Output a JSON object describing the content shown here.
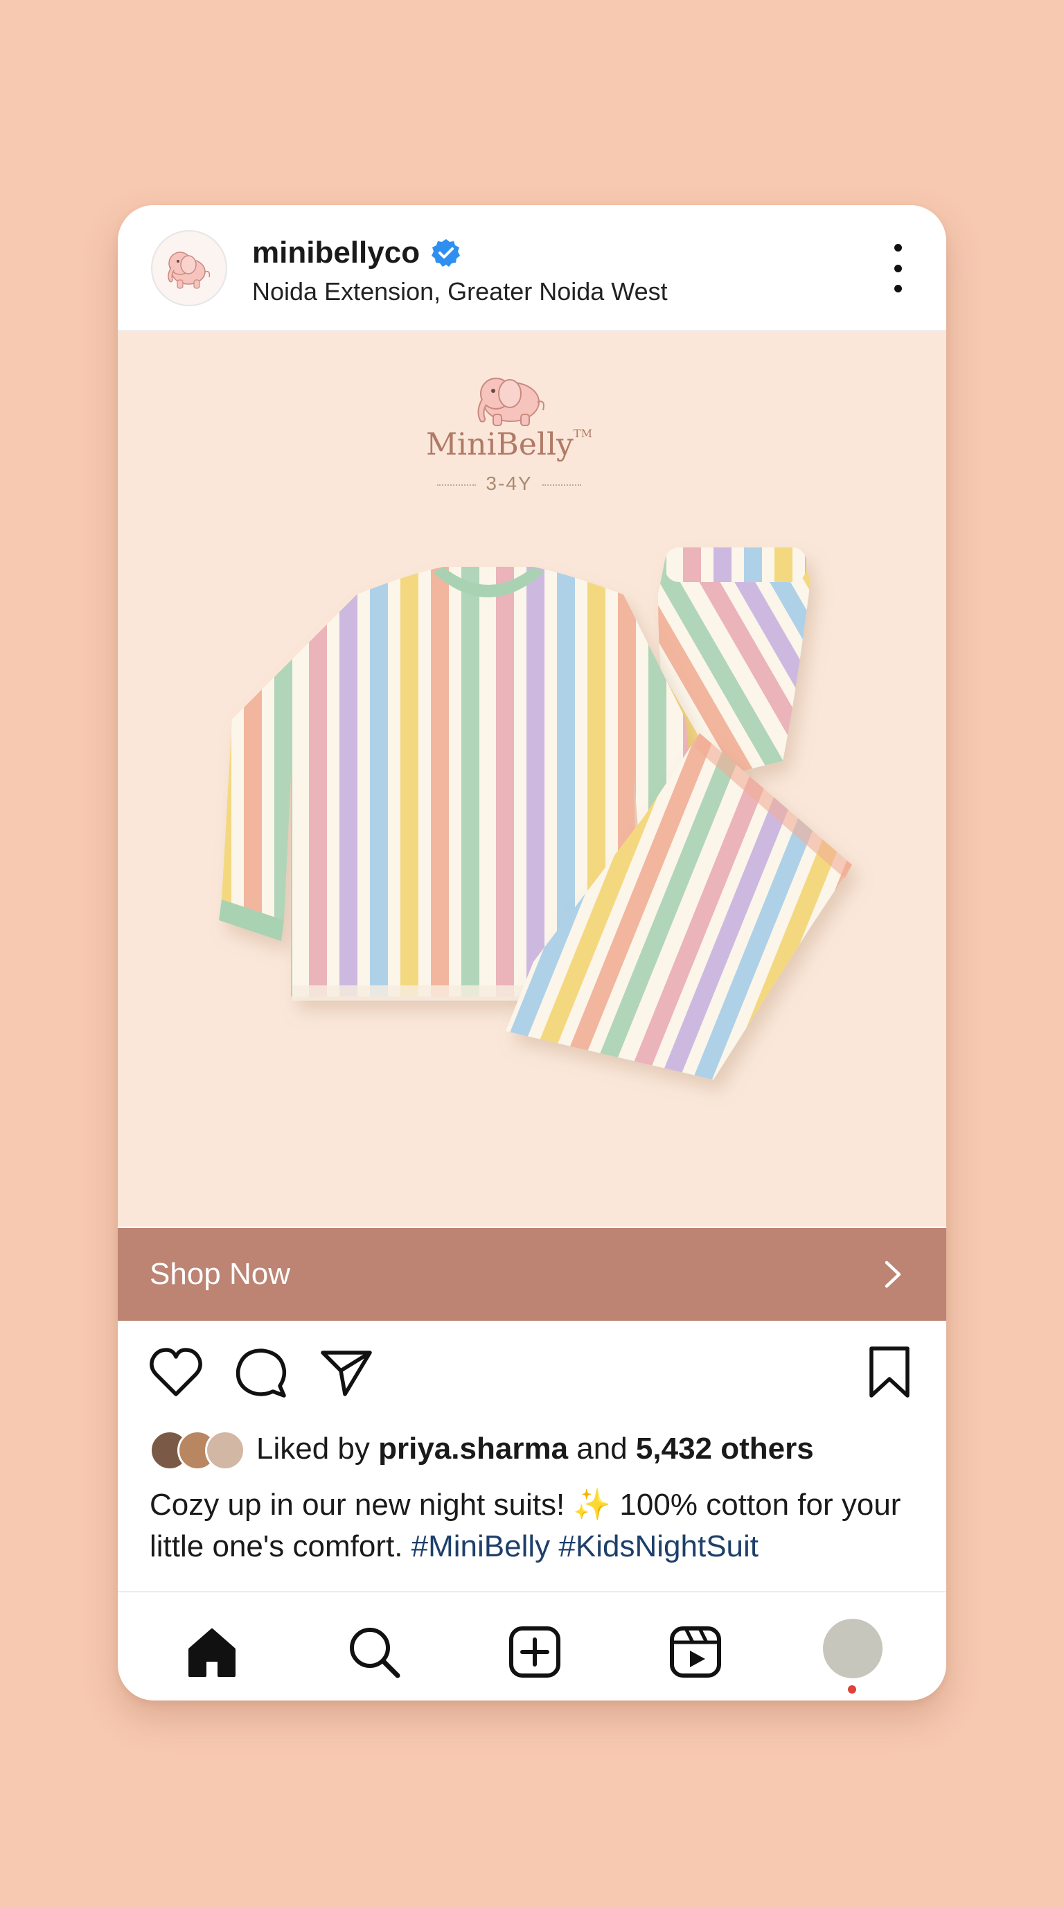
{
  "post": {
    "username": "minibellyco",
    "location": "Noida Extension, Greater Noida West",
    "verified": true,
    "accent_verified": "#2f8ff0"
  },
  "image": {
    "brand_name": "MiniBelly",
    "brand_tm": "TM",
    "size_label": "3-4Y",
    "icon": "elephant-logo-icon"
  },
  "cta": {
    "label": "Shop Now",
    "color": "#bd8473"
  },
  "actions": {
    "icons": [
      "heart-icon",
      "comment-icon",
      "share-icon",
      "bookmark-icon"
    ]
  },
  "likes": {
    "prefix": "Liked by ",
    "user": "priya.sharma",
    "middle": " and ",
    "count": "5,432 others"
  },
  "caption": {
    "text": "Cozy up in our new night suits! ✨ 100% cotton for your little one's comfort. ",
    "tags": [
      "#MiniBelly",
      "#KidsNightSuit"
    ]
  },
  "nav": {
    "items": [
      "home-icon",
      "search-icon",
      "create-icon",
      "reels-icon",
      "profile-avatar"
    ]
  }
}
